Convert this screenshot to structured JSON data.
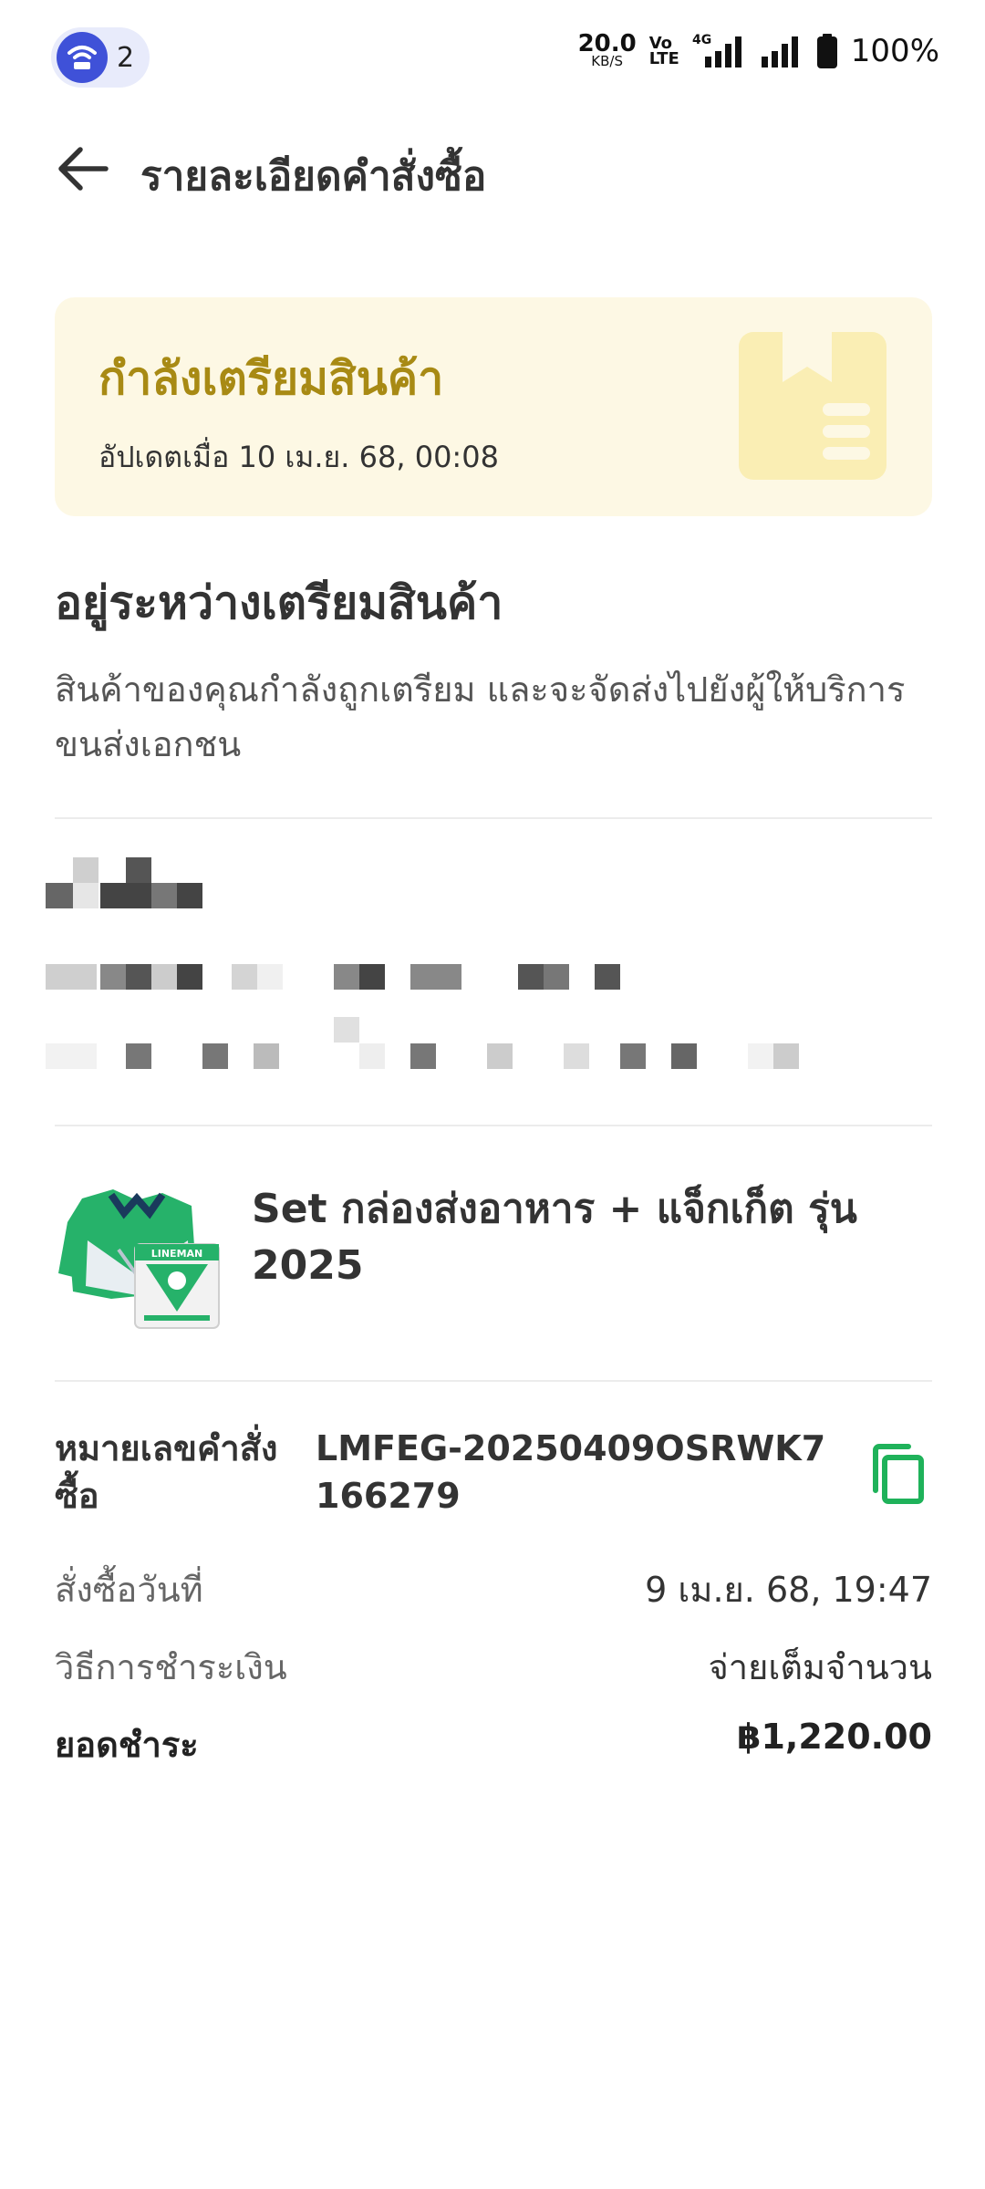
{
  "status_bar": {
    "hotspot_count": "2",
    "net_speed": "20.0",
    "net_speed_unit": "KB/S",
    "volte_top": "Vo",
    "volte_bottom": "LTE",
    "network_type": "4G",
    "battery": "100%"
  },
  "header": {
    "title": "รายละเอียดคำสั่งซื้อ"
  },
  "status_card": {
    "title": "กำลังเตรียมสินค้า",
    "updated": "อัปเดตเมื่อ 10 เม.ย. 68, 00:08",
    "accent_color": "#a88a14",
    "background": "#fdf8e4"
  },
  "section": {
    "heading": "อยู่ระหว่างเตรียมสินค้า",
    "description": "สินค้าของคุณกำลังถูกเตรียม และจะจัดส่งไปยังผู้ให้บริการขนส่งเอกชน"
  },
  "product": {
    "name": "Set กล่องส่งอาหาร + แจ็กเก็ต รุ่น 2025",
    "box_logo_text": "LINEMAN"
  },
  "order": {
    "number_label": "หมายเลขคำสั่งซื้อ",
    "number_value": "LMFEG-20250409OSRWK7166279",
    "date_label": "สั่งซื้อวันที่",
    "date_value": "9 เม.ย. 68, 19:47",
    "payment_label": "วิธีการชำระเงิน",
    "payment_value": "จ่ายเต็มจำนวน",
    "total_label": "ยอดชำระ",
    "total_value": "฿1,220.00",
    "copy_icon_color": "#1fb25a"
  }
}
